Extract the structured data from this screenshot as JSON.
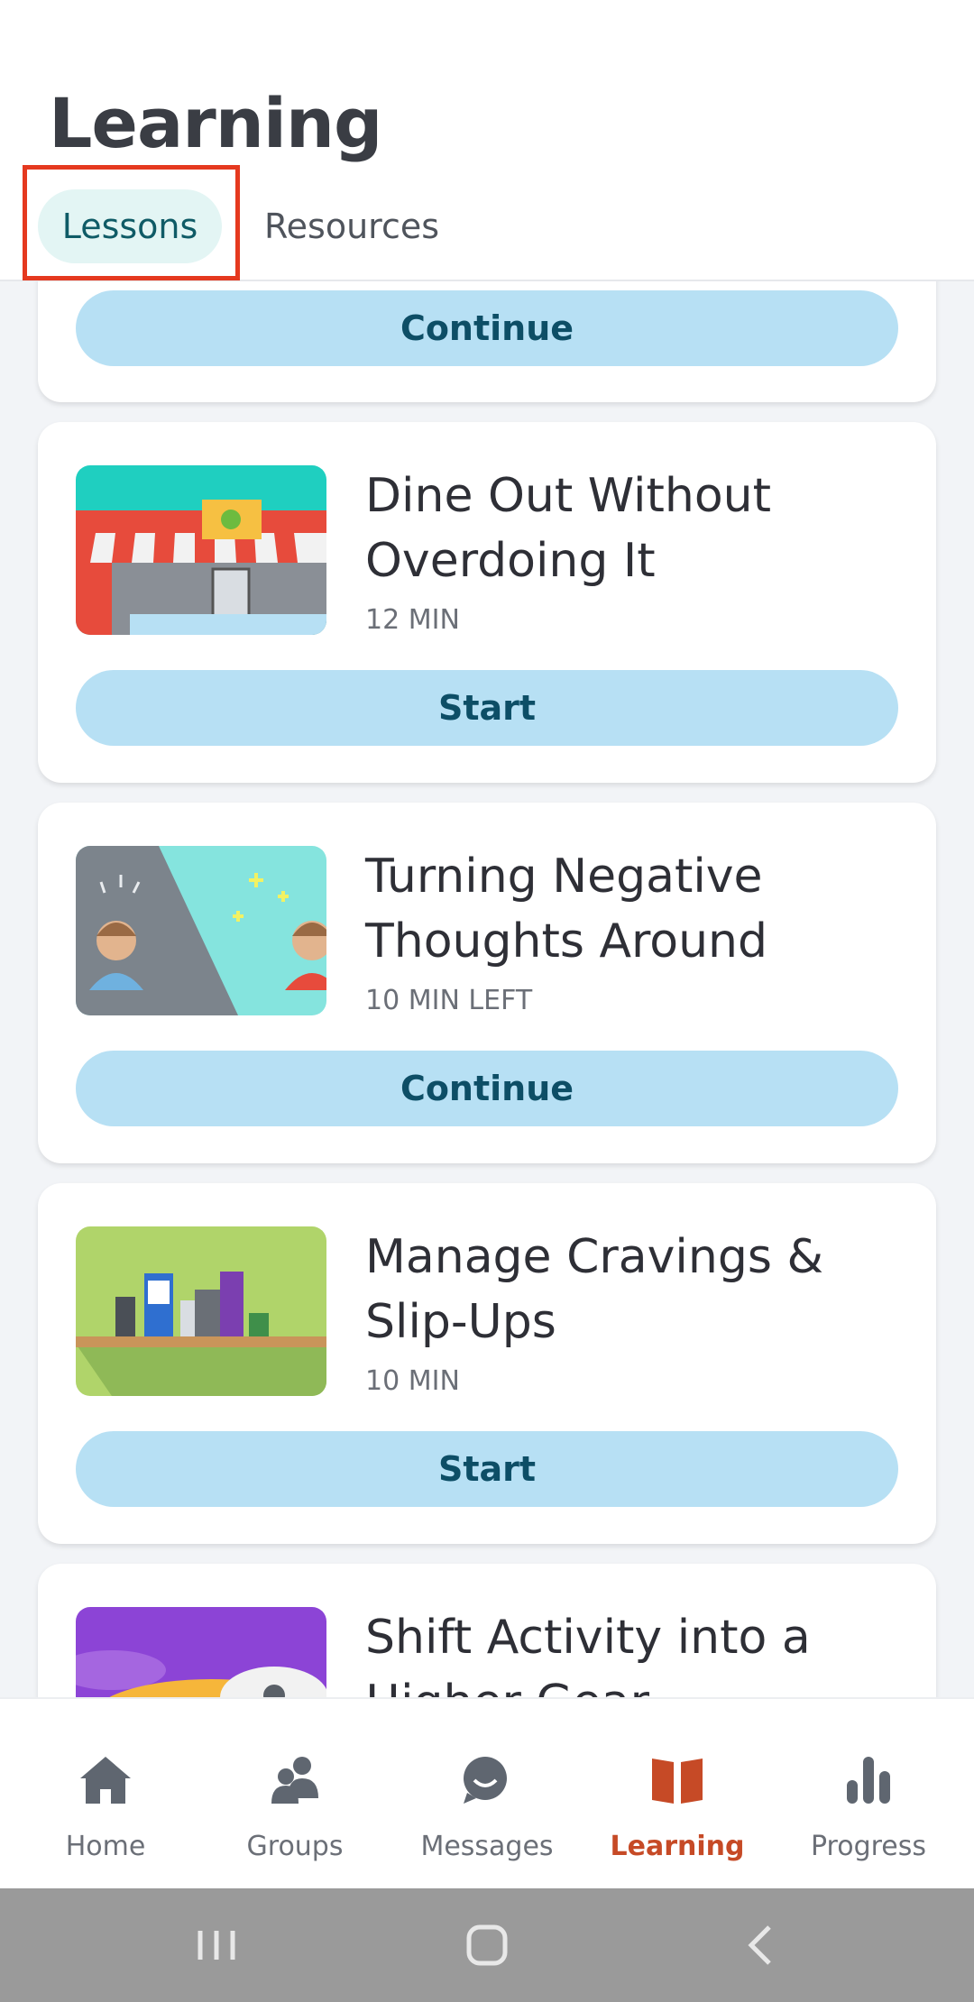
{
  "header": {
    "title": "Learning",
    "tabs": [
      {
        "label": "Lessons",
        "selected": true
      },
      {
        "label": "Resources",
        "selected": false
      }
    ]
  },
  "lessons": [
    {
      "title": "",
      "meta": "",
      "action": "Continue"
    },
    {
      "title": "Dine Out Without Overdoing It",
      "meta": "12 MIN",
      "action": "Start",
      "thumbnail": "storefront-illustration"
    },
    {
      "title": "Turning Negative Thoughts Around",
      "meta": "10 MIN LEFT",
      "action": "Continue",
      "thumbnail": "negative-thoughts-illustration"
    },
    {
      "title": "Manage Cravings & Slip-Ups",
      "meta": "10 MIN",
      "action": "Start",
      "thumbnail": "pantry-shelf-illustration"
    },
    {
      "title": "Shift Activity into a Higher Gear",
      "meta": "",
      "action": "",
      "thumbnail": "rocket-illustration"
    }
  ],
  "nav": {
    "items": [
      {
        "label": "Home",
        "icon": "home-icon"
      },
      {
        "label": "Groups",
        "icon": "groups-icon"
      },
      {
        "label": "Messages",
        "icon": "messages-icon"
      },
      {
        "label": "Learning",
        "icon": "book-icon",
        "active": true
      },
      {
        "label": "Progress",
        "icon": "bar-chart-icon"
      }
    ]
  },
  "colors": {
    "accent": "#c64a26",
    "button": "#b7e0f4",
    "button_text": "#0d4e66",
    "tab_selected_bg": "#e3f5f4",
    "highlight": "#e5391f"
  }
}
